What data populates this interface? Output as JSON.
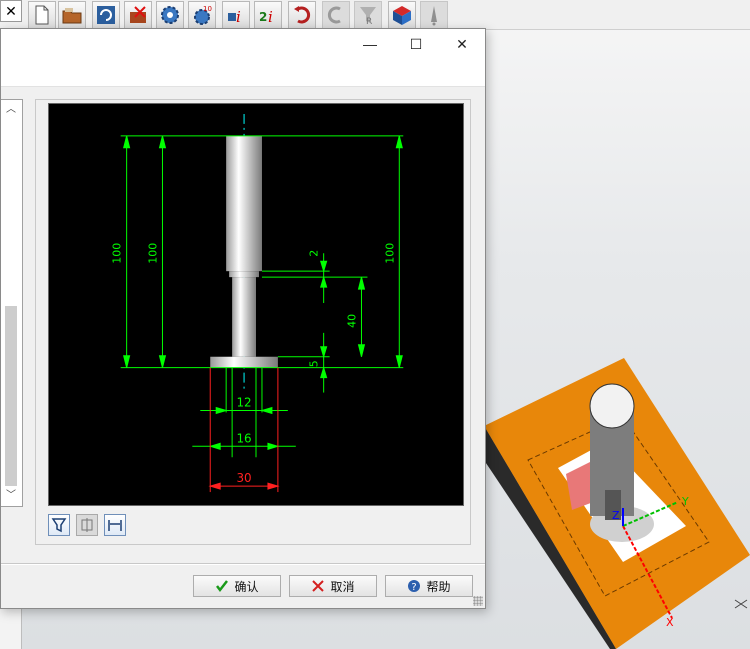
{
  "toolbar": {
    "close_glyph": "✕",
    "icons": [
      "new-file-icon",
      "open-folder-icon",
      "import-icon",
      "export-icon",
      "gear-icon",
      "numbered-gear-icon",
      "info-icon",
      "info-two-icon",
      "undo-icon",
      "redo-icon",
      "filter-r-icon",
      "cube-icon",
      "warning-icon"
    ]
  },
  "dialog": {
    "title": "",
    "window_controls": {
      "minimize": "—",
      "maximize": "☐",
      "close": "✕"
    },
    "scroll": {
      "up": "︿",
      "down": "﹀"
    }
  },
  "drawing": {
    "dims": {
      "total_left_outer": "100",
      "total_left_inner": "100",
      "total_right": "100",
      "step_gap": "2",
      "lower_len": "40",
      "flange_thk": "5",
      "dia_small": "12",
      "dia_mid": "16",
      "dia_flange": "30"
    },
    "colors": {
      "dim": "#00ff00",
      "critical": "#ff2020",
      "center": "#00ffff",
      "bg": "#000000"
    }
  },
  "buttons": {
    "ok": "确认",
    "cancel": "取消",
    "help": "帮助"
  },
  "scene": {
    "axes": {
      "x": "X",
      "y": "Y",
      "z": "Z"
    },
    "colors": {
      "block": "#e8870a",
      "cylinder": "#7d7d7d",
      "axis_x": "#ff0000",
      "axis_y": "#00c000",
      "axis_z": "#0000ff"
    }
  }
}
